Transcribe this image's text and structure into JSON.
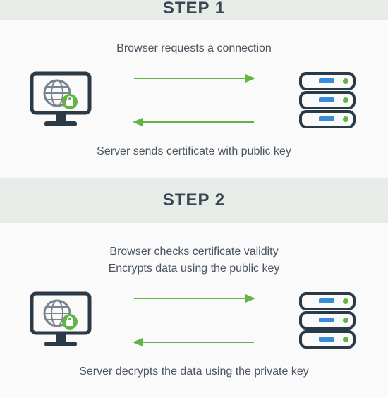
{
  "colors": {
    "header_bg": "#e8ece9",
    "header_text": "#3a4651",
    "body_text": "#4a5560",
    "arrow": "#62b445",
    "device_stroke": "#2b3a47",
    "accent_blue": "#3a8bd8"
  },
  "steps": [
    {
      "heading": "STEP 1",
      "top_captions": [
        "Browser requests a connection"
      ],
      "bottom_captions": [
        "Server sends certificate with public key"
      ]
    },
    {
      "heading": "STEP 2",
      "top_captions": [
        "Browser checks certificate validity",
        "Encrypts data using the public key"
      ],
      "bottom_captions": [
        "Server decrypts the data using the private key"
      ]
    }
  ],
  "icons": {
    "left": "browser-lock-icon",
    "right": "server-stack-icon"
  }
}
